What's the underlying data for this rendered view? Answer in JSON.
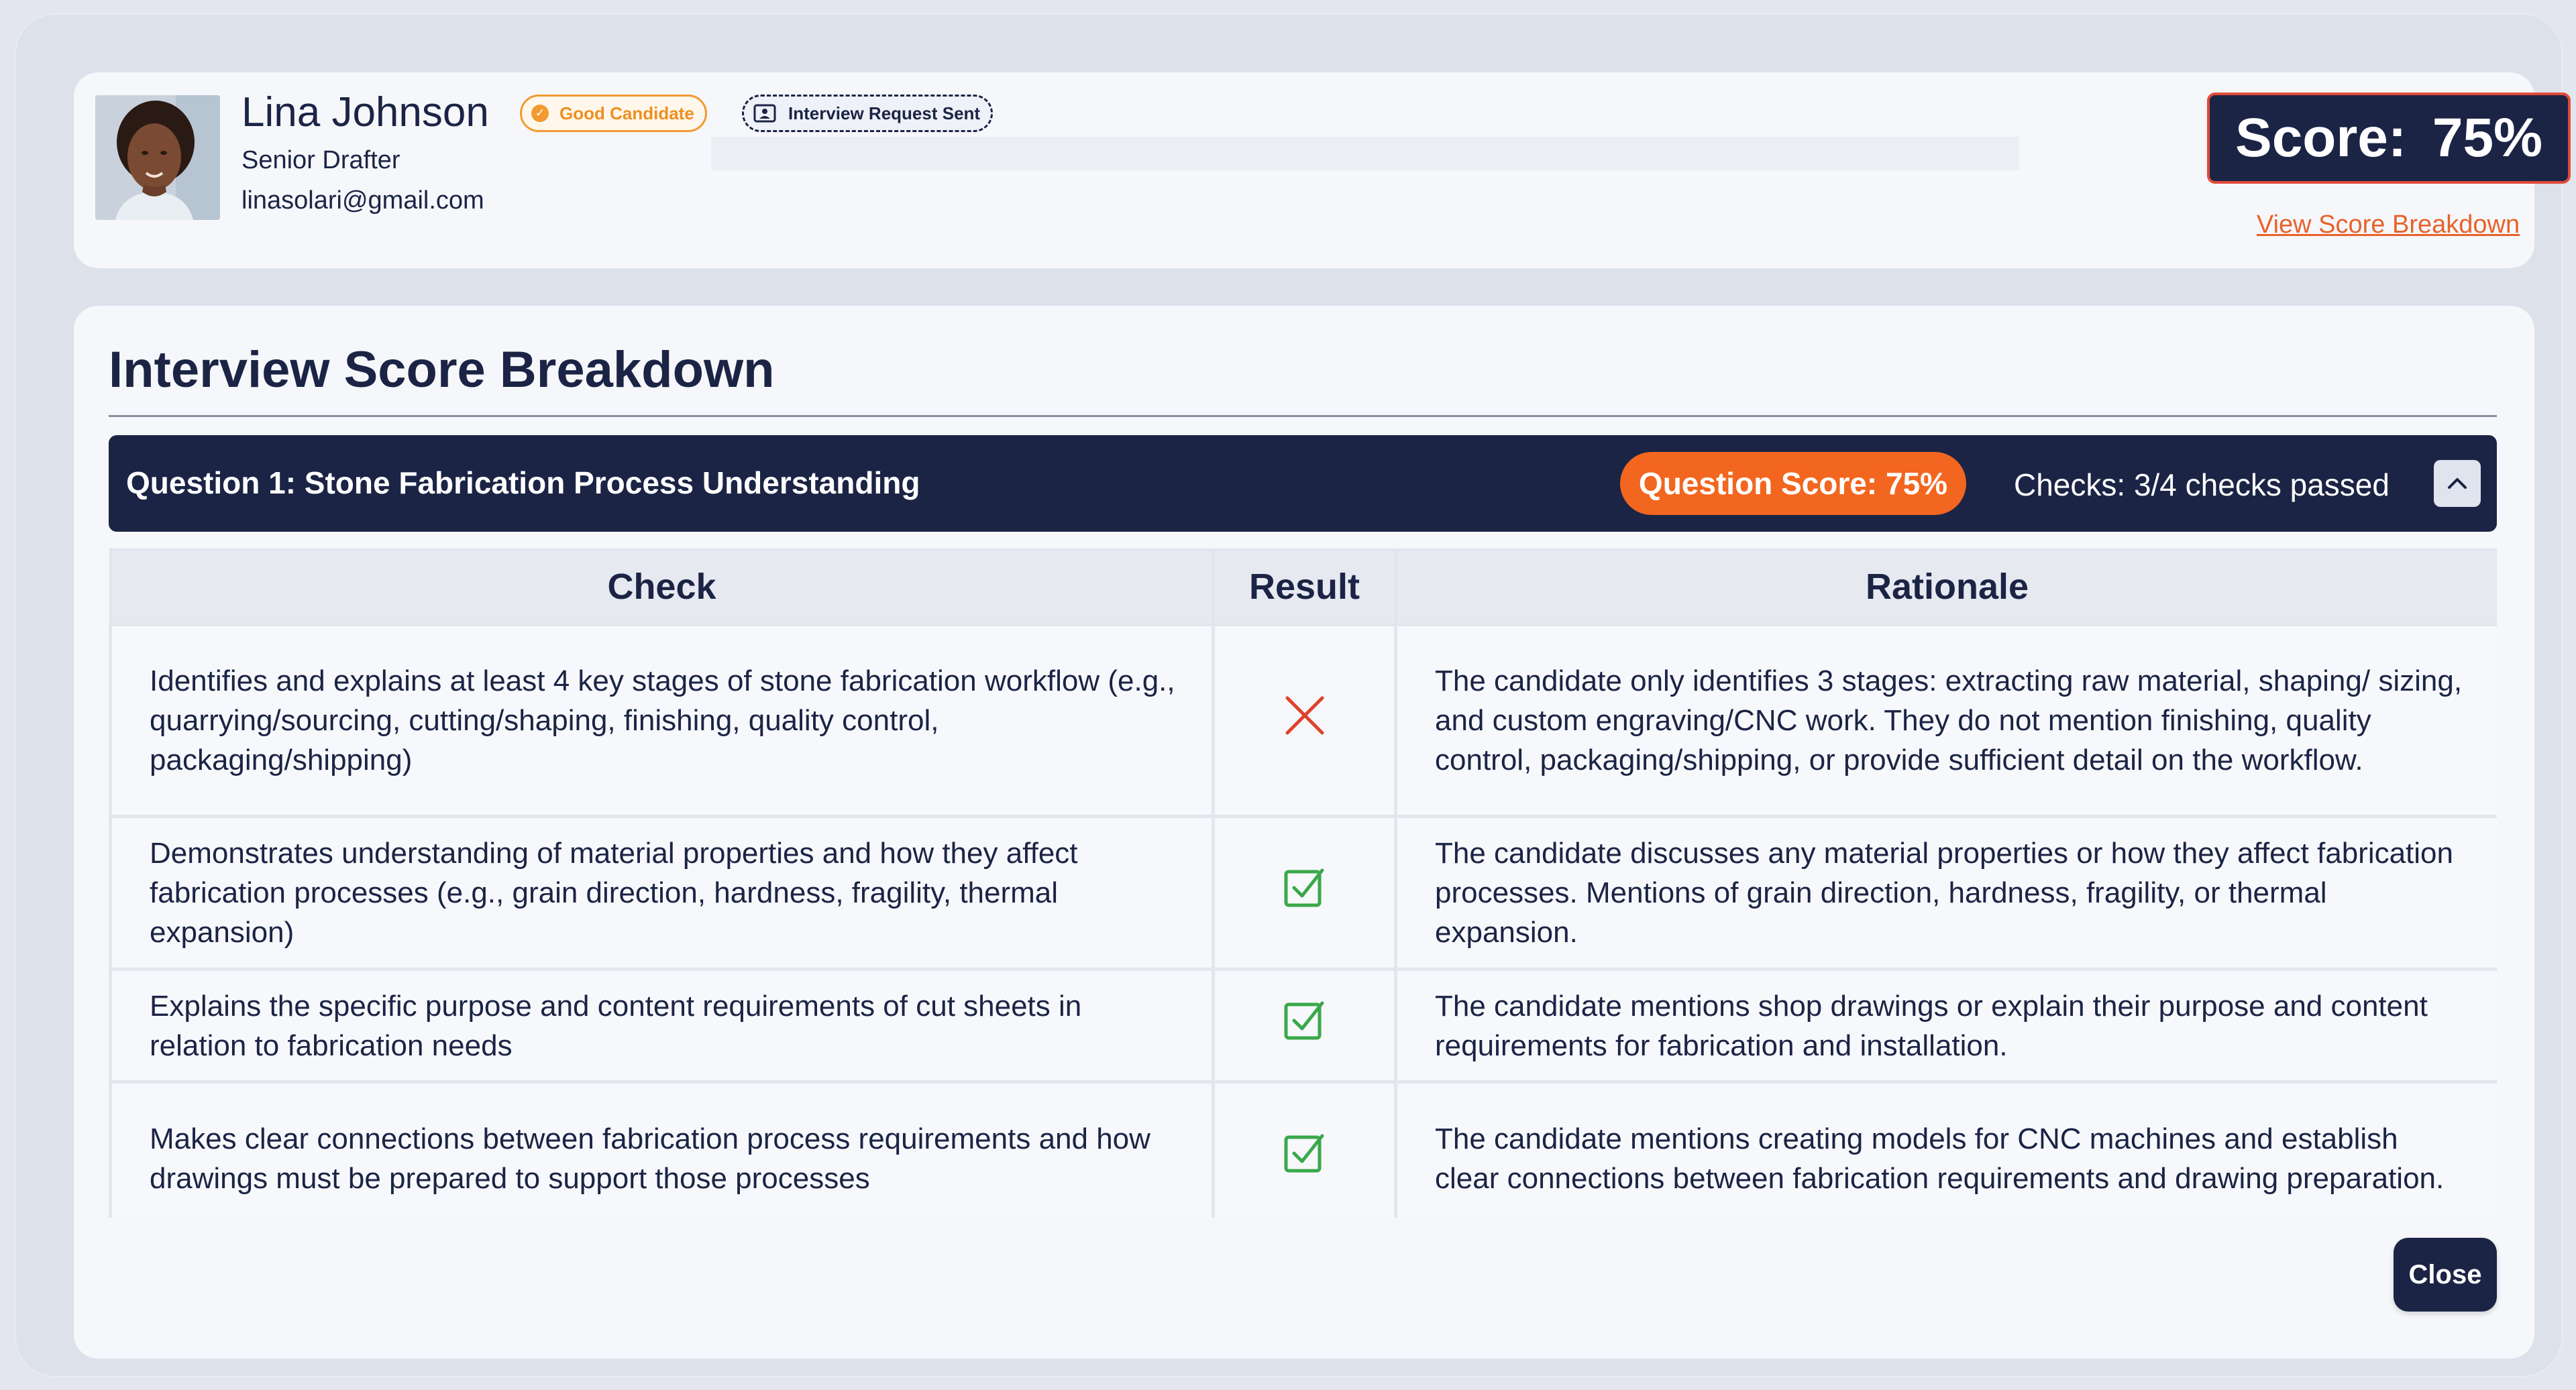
{
  "candidate": {
    "name": "Lina Johnson",
    "title": "Senior Drafter",
    "email": "linasolari@gmail.com",
    "status_badge": "Good Candidate",
    "interview_badge": "Interview Request Sent"
  },
  "score": {
    "label": "Score:",
    "value": "75%",
    "breakdown_link": "View Score Breakdown"
  },
  "breakdown": {
    "title": "Interview Score Breakdown",
    "question": {
      "title": "Question 1: Stone Fabrication Process Understanding",
      "score": "Question Score: 75%",
      "checks": "Checks: 3/4 checks passed"
    },
    "columns": [
      "Check",
      "Result",
      "Rationale"
    ],
    "rows": [
      {
        "check": "Identifies and explains at least 4 key stages of stone fabrication workflow (e.g., quarrying/sourcing, cutting/shaping, finishing, quality control, packaging/shipping)",
        "result": "fail",
        "rationale": "The candidate only identifies 3 stages: extracting raw material, shaping/ sizing, and custom engraving/CNC work. They do not mention finishing, quality control, packaging/shipping, or provide sufficient detail on the workflow."
      },
      {
        "check": "Demonstrates understanding of material properties and how they affect fabrication processes (e.g., grain direction, hardness, fragility, thermal expansion)",
        "result": "pass",
        "rationale": "The candidate discusses any material properties or how they affect fabrication processes. Mentions of grain direction, hardness, fragility, or thermal expansion."
      },
      {
        "check": "Explains the specific purpose and content requirements of cut sheets in relation to fabrication needs",
        "result": "pass",
        "rationale": "The candidate mentions shop drawings or explain their purpose and content requirements for fabrication and installation."
      },
      {
        "check": "Makes clear connections between fabrication process requirements and how drawings must be prepared to support those processes",
        "result": "pass",
        "rationale": "The candidate mentions creating models for CNC machines and establish clear connections between fabrication requirements and drawing preparation."
      }
    ]
  },
  "actions": {
    "close_label": "Close"
  },
  "colors": {
    "navy": "#1b2445",
    "orange": "#f2661f",
    "pass_green": "#3aa84a",
    "fail_red": "#e0412c"
  }
}
